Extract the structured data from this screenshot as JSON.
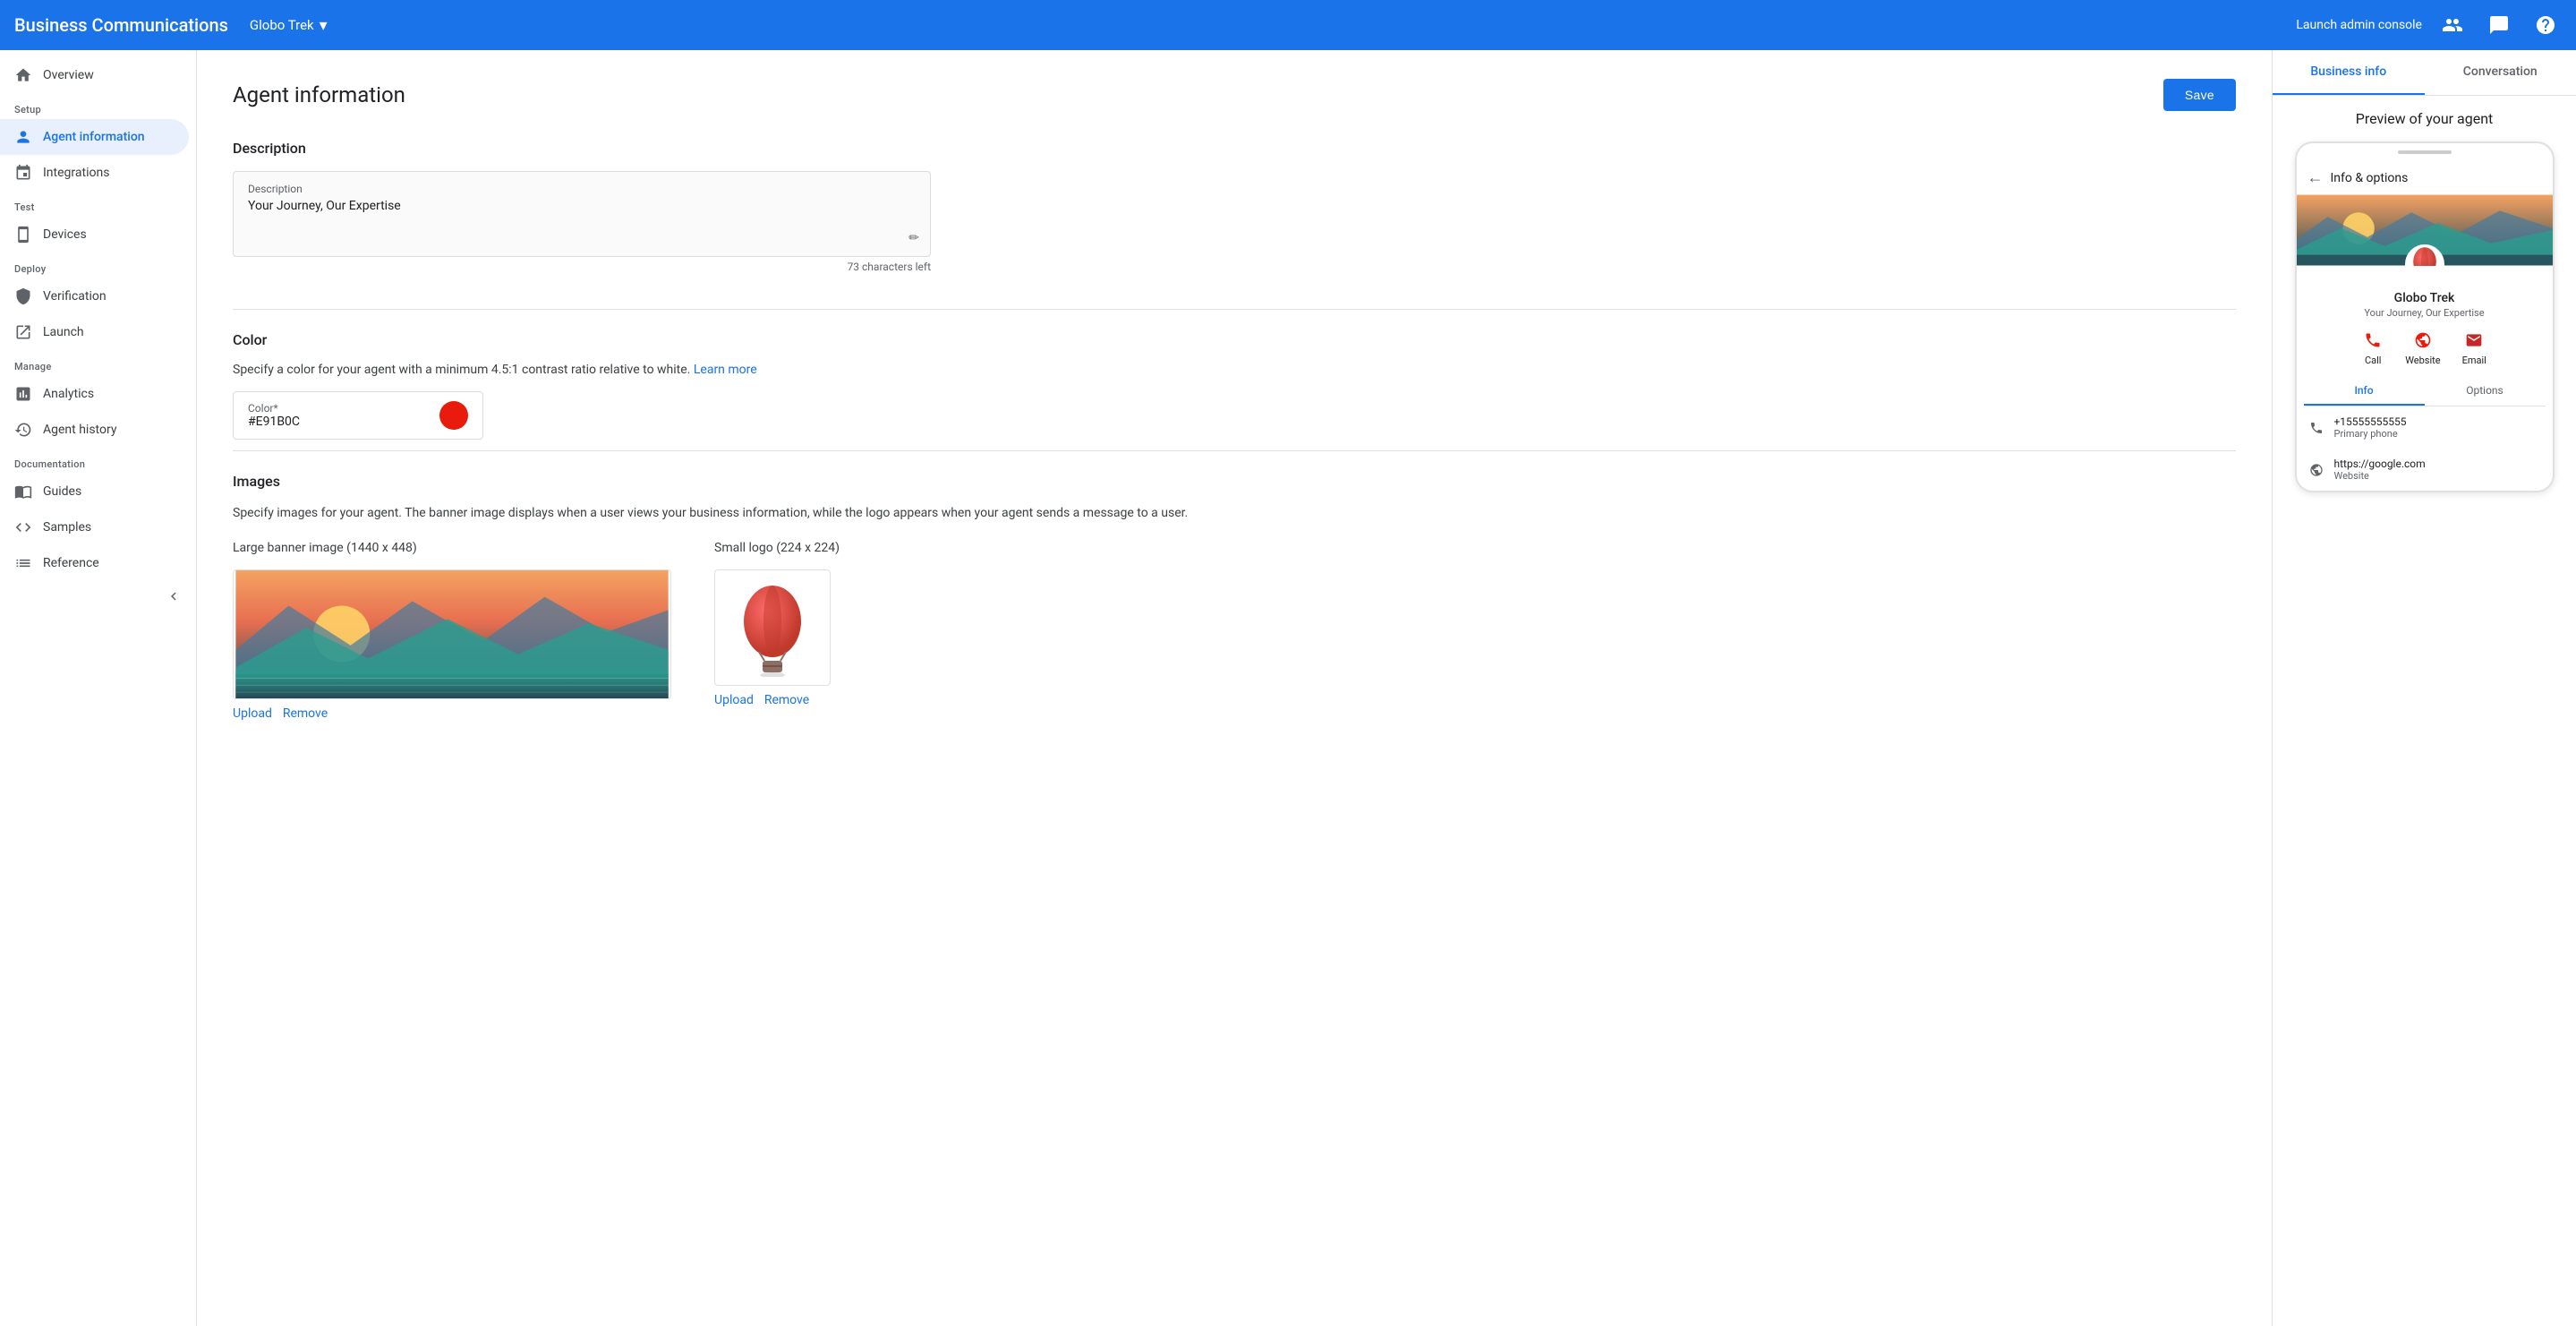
{
  "topNav": {
    "appTitle": "Business Communications",
    "brandName": "Globo Trek",
    "launchAdminConsole": "Launch admin console"
  },
  "sidebar": {
    "sections": [
      {
        "label": "",
        "items": [
          {
            "id": "overview",
            "label": "Overview",
            "icon": "home"
          }
        ]
      },
      {
        "label": "Setup",
        "items": [
          {
            "id": "agent-information",
            "label": "Agent information",
            "icon": "person",
            "active": true
          },
          {
            "id": "integrations",
            "label": "Integrations",
            "icon": "integrations"
          }
        ]
      },
      {
        "label": "Test",
        "items": [
          {
            "id": "devices",
            "label": "Devices",
            "icon": "phone"
          }
        ]
      },
      {
        "label": "Deploy",
        "items": [
          {
            "id": "verification",
            "label": "Verification",
            "icon": "shield"
          },
          {
            "id": "launch",
            "label": "Launch",
            "icon": "launch"
          }
        ]
      },
      {
        "label": "Manage",
        "items": [
          {
            "id": "analytics",
            "label": "Analytics",
            "icon": "analytics"
          },
          {
            "id": "agent-history",
            "label": "Agent history",
            "icon": "history"
          }
        ]
      },
      {
        "label": "Documentation",
        "items": [
          {
            "id": "guides",
            "label": "Guides",
            "icon": "book"
          },
          {
            "id": "samples",
            "label": "Samples",
            "icon": "code"
          },
          {
            "id": "reference",
            "label": "Reference",
            "icon": "list"
          }
        ]
      }
    ]
  },
  "main": {
    "pageTitle": "Agent information",
    "saveLabel": "Save",
    "description": {
      "sectionTitle": "Description",
      "fieldLabel": "Description",
      "fieldValue": "Your Journey, Our Expertise",
      "charsLeft": "73 characters left"
    },
    "color": {
      "sectionTitle": "Color",
      "description": "Specify a color for your agent with a minimum 4.5:1 contrast ratio relative to white.",
      "learnMoreLabel": "Learn more",
      "learnMoreUrl": "#",
      "fieldLabel": "Color*",
      "fieldValue": "#E91B0C",
      "swatchColor": "#E91B0C"
    },
    "images": {
      "sectionTitle": "Images",
      "description": "Specify images for your agent. The banner image displays when a user views your business information, while the logo appears when your agent sends a message to a user.",
      "bannerLabel": "Large banner image (1440 x 448)",
      "logoLabel": "Small logo (224 x 224)",
      "uploadLabel": "Upload",
      "removeLabel": "Remove"
    }
  },
  "rightPanel": {
    "tabs": [
      {
        "id": "business-info",
        "label": "Business info",
        "active": true
      },
      {
        "id": "conversation",
        "label": "Conversation",
        "active": false
      }
    ],
    "preview": {
      "title": "Preview of your agent",
      "headerLabel": "Info & options",
      "businessName": "Globo Trek",
      "businessDesc": "Your Journey, Our Expertise",
      "actions": [
        {
          "id": "call",
          "label": "Call"
        },
        {
          "id": "website",
          "label": "Website"
        },
        {
          "id": "email",
          "label": "Email"
        }
      ],
      "phoneTabs": [
        {
          "id": "info",
          "label": "Info",
          "active": true
        },
        {
          "id": "options",
          "label": "Options",
          "active": false
        }
      ],
      "infoItems": [
        {
          "id": "phone",
          "main": "+15555555555",
          "sub": "Primary phone"
        },
        {
          "id": "website",
          "main": "https://google.com",
          "sub": "Website"
        }
      ]
    }
  }
}
